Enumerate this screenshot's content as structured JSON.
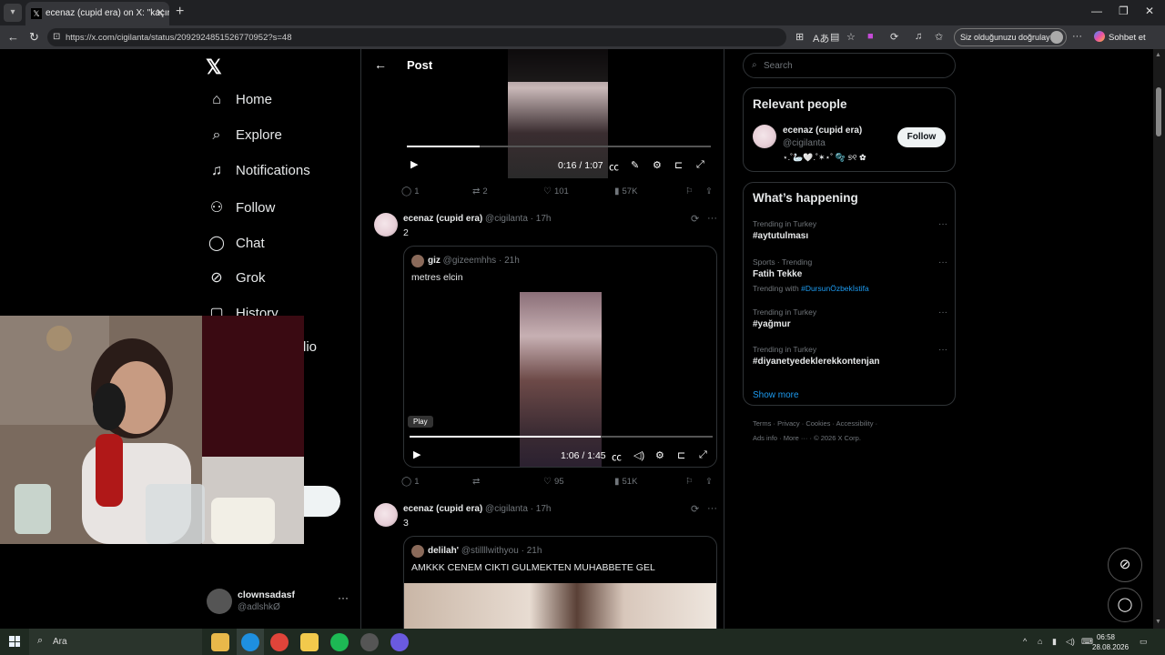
{
  "browser": {
    "tab_title": "ecenaz (cupid era) on X: \"kaçıranla",
    "url": "https://x.com/cigilanta/status/2092924851526770952?s=48",
    "verify_label": "Siz olduğunuzu doğrulayın",
    "copilot_label": "Sohbet et"
  },
  "nav": {
    "items": [
      {
        "label": "Home",
        "icon": "home-icon"
      },
      {
        "label": "Explore",
        "icon": "search-icon"
      },
      {
        "label": "Notifications",
        "icon": "bell-icon"
      },
      {
        "label": "Follow",
        "icon": "follow-icon"
      },
      {
        "label": "Chat",
        "icon": "chat-icon"
      },
      {
        "label": "Grok",
        "icon": "grok-icon"
      },
      {
        "label": "History",
        "icon": "history-icon"
      }
    ],
    "partial_label": "lio",
    "account": {
      "name": "clownsadasf",
      "handle": "@adlshkØ"
    }
  },
  "header": {
    "title": "Post"
  },
  "top_video": {
    "time": "0:16 / 1:07",
    "progress": 0.24
  },
  "tweets": [
    {
      "actions": {
        "replies": "1",
        "reposts": "2",
        "likes": "101",
        "views": "57K"
      }
    },
    {
      "author": "ecenaz (cupid era)",
      "handle": "@cigilanta",
      "time": "17h",
      "text": "2",
      "quote": {
        "author": "giz",
        "handle": "@gizeemhhs",
        "time": "21h",
        "text": "metres elcin"
      },
      "video": {
        "time": "1:06 / 1:45",
        "progress": 0.63,
        "tooltip": "Play"
      },
      "actions": {
        "replies": "1",
        "reposts": "",
        "likes": "95",
        "views": "51K"
      }
    },
    {
      "author": "ecenaz (cupid era)",
      "handle": "@cigilanta",
      "time": "17h",
      "text": "3",
      "quote": {
        "author": "delilah'",
        "handle": "@stillllwithyou",
        "time": "21h",
        "text": "AMKKK CENEM CIKTI GULMEKTEN MUHABBETE GEL"
      }
    }
  ],
  "right": {
    "search_placeholder": "Search",
    "relevant": {
      "title": "Relevant people",
      "name": "ecenaz (cupid era)",
      "handle": "@cigilanta",
      "bio": "⋆.˚🦢🤍.˚✶⋆˚ 🫧 ୭୧ ✿",
      "follow_label": "Follow"
    },
    "happening": {
      "title": "What’s happening",
      "trends": [
        {
          "context": "Trending in Turkey",
          "title": "#aytutulması",
          "with_label": "",
          "with_tag": ""
        },
        {
          "context": "Sports · Trending",
          "title": "Fatih Tekke",
          "with_label": "Trending with",
          "with_tag": "#DursunÖzbekİstifa"
        },
        {
          "context": "Trending in Turkey",
          "title": "#yağmur",
          "with_label": "",
          "with_tag": ""
        },
        {
          "context": "Trending in Turkey",
          "title": "#diyanetyedeklerekkontenjan",
          "with_label": "",
          "with_tag": ""
        }
      ],
      "show_more": "Show more"
    },
    "footer_line1": "Terms  ·  Privacy  ·  Cookies  ·  Accessibility  ·",
    "footer_line2": "Ads info  ·  More ···  ·  © 2026 X Corp."
  },
  "taskbar": {
    "search_label": "Ara",
    "time": "06:58",
    "date": "28.08.2026"
  },
  "colors": {
    "accent": "#1d9bf0",
    "background": "#000000",
    "border": "#2f3336",
    "muted": "#71767b"
  }
}
